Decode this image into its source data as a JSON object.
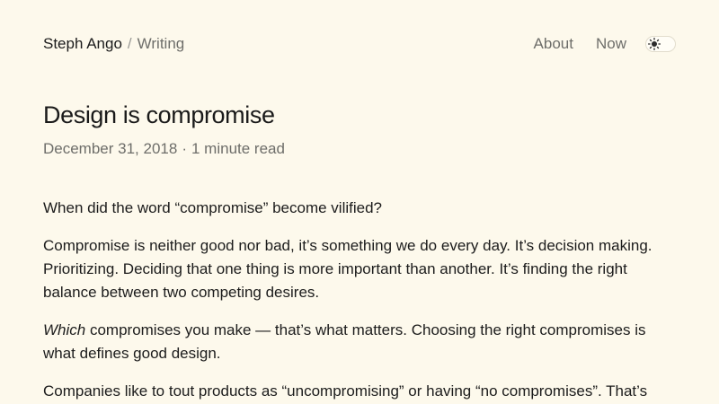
{
  "header": {
    "site_name": "Steph Ango",
    "separator": "/",
    "section": "Writing",
    "nav": [
      {
        "label": "About"
      },
      {
        "label": "Now"
      }
    ],
    "theme_toggle_icon": "sun-icon"
  },
  "post": {
    "title": "Design is compromise",
    "date": "December 31, 2018",
    "dot": "·",
    "read_time": "1 minute read",
    "paragraphs": {
      "p1": "When did the word “compromise” become vilified?",
      "p2": "Compromise is neither good nor bad, it’s something we do every day. It’s decision making. Prioritizing. Deciding that one thing is more important than another. It’s finding the right balance between two competing desires.",
      "p3_em": "Which",
      "p3_rest": " compromises you make  — that’s what matters. Choosing the right compromises is what defines good design.",
      "p4": "Companies like to tout products as “uncompromising” or having “no compromises”. That’s"
    }
  },
  "colors": {
    "background": "#fdf9ec",
    "text": "#1c1c1c",
    "muted": "#6e6e6a"
  }
}
